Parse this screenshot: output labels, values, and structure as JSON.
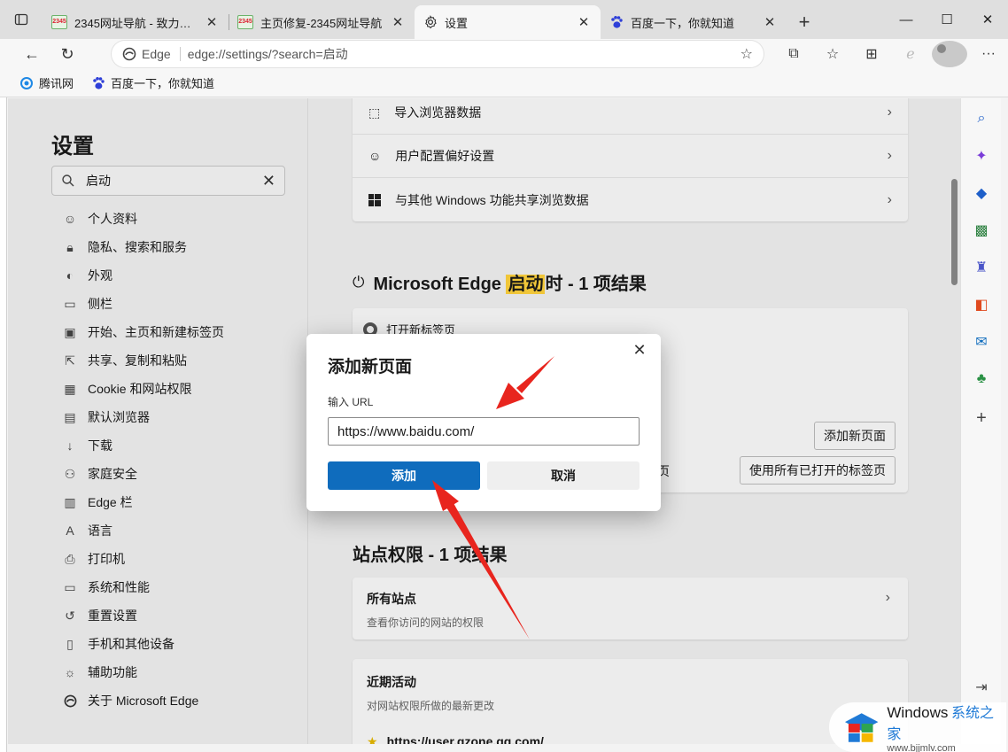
{
  "tabs": [
    {
      "title": "2345网址导航 - 致力于打造百",
      "icon": "2345-icon"
    },
    {
      "title": "主页修复-2345网址导航",
      "icon": "2345-icon"
    },
    {
      "title": "设置",
      "icon": "gear-icon",
      "active": true
    },
    {
      "title": "百度一下，你就知道",
      "icon": "baidu-paw-icon"
    }
  ],
  "address": {
    "chip": "Edge",
    "url": "edge://settings/?search=启动"
  },
  "favorites": [
    {
      "label": "腾讯网",
      "icon": "tencent-icon"
    },
    {
      "label": "百度一下，你就知道",
      "icon": "baidu-paw-icon"
    }
  ],
  "settings": {
    "title": "设置",
    "search_value": "启动",
    "nav": [
      {
        "label": "个人资料",
        "icon": "person-icon"
      },
      {
        "label": "隐私、搜索和服务",
        "icon": "lock-icon"
      },
      {
        "label": "外观",
        "icon": "palette-icon"
      },
      {
        "label": "侧栏",
        "icon": "sidebar-icon"
      },
      {
        "label": "开始、主页和新建标签页",
        "icon": "home-icon"
      },
      {
        "label": "共享、复制和粘贴",
        "icon": "share-icon"
      },
      {
        "label": "Cookie 和网站权限",
        "icon": "cookie-icon"
      },
      {
        "label": "默认浏览器",
        "icon": "browser-icon"
      },
      {
        "label": "下载",
        "icon": "download-icon"
      },
      {
        "label": "家庭安全",
        "icon": "family-icon"
      },
      {
        "label": "Edge 栏",
        "icon": "edge-bar-icon"
      },
      {
        "label": "语言",
        "icon": "language-icon"
      },
      {
        "label": "打印机",
        "icon": "printer-icon"
      },
      {
        "label": "系统和性能",
        "icon": "laptop-icon"
      },
      {
        "label": "重置设置",
        "icon": "reset-icon"
      },
      {
        "label": "手机和其他设备",
        "icon": "phone-icon"
      },
      {
        "label": "辅助功能",
        "icon": "accessibility-icon"
      },
      {
        "label": "关于 Microsoft Edge",
        "icon": "edge-logo-icon"
      }
    ]
  },
  "content": {
    "import_rows": [
      {
        "label": "导入浏览器数据",
        "icon": "import-icon"
      },
      {
        "label": "用户配置偏好设置",
        "icon": "profile-settings-icon"
      },
      {
        "label": "与其他 Windows 功能共享浏览数据",
        "icon": "windows-icon"
      }
    ],
    "startup_title_pre": "Microsoft Edge ",
    "startup_title_hl": "启动",
    "startup_title_post": "时 - 1 项结果",
    "startup_option": "打开新标签页",
    "add_new_page_btn": "添加新页面",
    "use_open_tabs_btn": "使用所有已打开的标签页",
    "partial_text": "页",
    "site_perm_title": "站点权限 - 1 项结果",
    "all_sites_title": "所有站点",
    "all_sites_sub": "查看你访问的网站的权限",
    "recent_title": "近期活动",
    "recent_sub": "对网站权限所做的最新更改",
    "recent_site": "https://user.qzone.qq.com/"
  },
  "dialog": {
    "title": "添加新页面",
    "url_label": "输入 URL",
    "url_value": "https://www.baidu.com/",
    "add_btn": "添加",
    "cancel_btn": "取消"
  },
  "watermark": {
    "line1": "Windows",
    "line1b": "系统之家",
    "line2": "www.bjjmlv.com"
  },
  "colors": {
    "accent": "#0f6cbd",
    "highlight": "#ffd33d",
    "arrow": "#e8251e"
  }
}
